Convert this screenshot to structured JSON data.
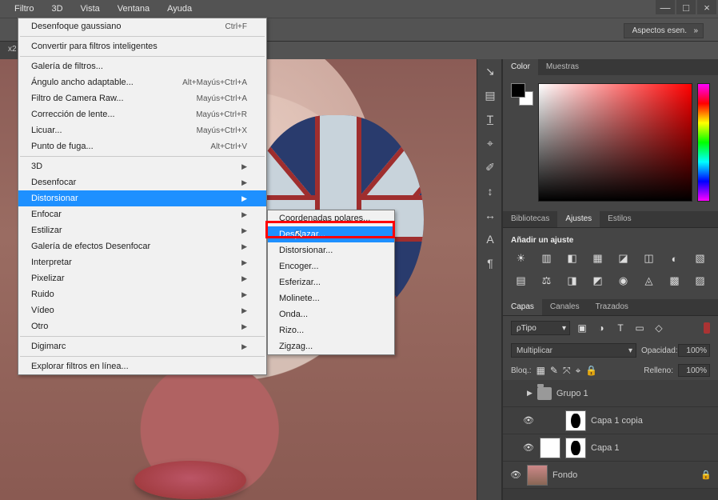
{
  "menubar": {
    "items": [
      "Filtro",
      "3D",
      "Vista",
      "Ventana",
      "Ayuda"
    ]
  },
  "win": {
    "min": "—",
    "max": "□",
    "close": "×"
  },
  "optbar": {
    "aspectos": "Aspectos esen."
  },
  "doc_tab": "x2",
  "vstrip": [
    "↘",
    "▤",
    "T̲",
    "⌖",
    "✐",
    "↕",
    "↔",
    "A",
    "¶"
  ],
  "color_panel": {
    "tabs": [
      "Color",
      "Muestras"
    ],
    "active": 0
  },
  "adj_panel": {
    "tabs": [
      "Bibliotecas",
      "Ajustes",
      "Estilos"
    ],
    "active": 1,
    "title": "Añadir un ajuste",
    "icons_row1": [
      "☀",
      "▥",
      "◧",
      "▦",
      "◪",
      "◫",
      "◐",
      "▧"
    ],
    "icons_row2": [
      "▤",
      "⚖",
      "◨",
      "◩",
      "◉",
      "◬",
      "▩",
      "▨"
    ]
  },
  "lay_panel": {
    "tabs": [
      "Capas",
      "Canales",
      "Trazados"
    ],
    "active": 0,
    "kind_label": "Tipo",
    "filter_icons": [
      "▣",
      "◑",
      "T",
      "▭",
      "◇"
    ],
    "blend_mode": "Multiplicar",
    "opacity_label": "Opacidad:",
    "opacity_value": "100%",
    "lock_label": "Bloq.:",
    "lock_icons": [
      "▦",
      "✎",
      "⤧",
      "⌖",
      "🔒"
    ],
    "fill_label": "Relleno:",
    "fill_value": "100%",
    "layers": [
      {
        "eye": "",
        "group": true,
        "name": "Grupo 1"
      },
      {
        "eye": "👁",
        "hi": true,
        "flag": true,
        "mask": true,
        "name": "Capa 1 copia"
      },
      {
        "eye": "👁",
        "white": true,
        "mask": true,
        "name": "Capa 1"
      },
      {
        "eye": "👁",
        "img": true,
        "name": "Fondo",
        "lock": true
      }
    ]
  },
  "menu": {
    "title": "Filtro",
    "items": [
      {
        "label": "Desenfoque gaussiano",
        "shortcut": "Ctrl+F"
      },
      {
        "sep": true
      },
      {
        "label": "Convertir para filtros inteligentes"
      },
      {
        "sep": true
      },
      {
        "label": "Galería de filtros..."
      },
      {
        "label": "Ángulo ancho adaptable...",
        "shortcut": "Alt+Mayús+Ctrl+A"
      },
      {
        "label": "Filtro de Camera Raw...",
        "shortcut": "Mayús+Ctrl+A"
      },
      {
        "label": "Corrección de lente...",
        "shortcut": "Mayús+Ctrl+R"
      },
      {
        "label": "Licuar...",
        "shortcut": "Mayús+Ctrl+X"
      },
      {
        "label": "Punto de fuga...",
        "shortcut": "Alt+Ctrl+V"
      },
      {
        "sep": true
      },
      {
        "label": "3D",
        "sub": true
      },
      {
        "label": "Desenfocar",
        "sub": true
      },
      {
        "label": "Distorsionar",
        "sub": true,
        "hover": true
      },
      {
        "label": "Enfocar",
        "sub": true
      },
      {
        "label": "Estilizar",
        "sub": true
      },
      {
        "label": "Galería de efectos Desenfocar",
        "sub": true
      },
      {
        "label": "Interpretar",
        "sub": true
      },
      {
        "label": "Pixelizar",
        "sub": true
      },
      {
        "label": "Ruido",
        "sub": true
      },
      {
        "label": "Vídeo",
        "sub": true
      },
      {
        "label": "Otro",
        "sub": true
      },
      {
        "sep": true
      },
      {
        "label": "Digimarc",
        "sub": true
      },
      {
        "sep": true
      },
      {
        "label": "Explorar filtros en línea..."
      }
    ]
  },
  "submenu": {
    "items": [
      {
        "label": "Coordenadas polares..."
      },
      {
        "label": "Desplazar...",
        "hl": true
      },
      {
        "label": "Distorsionar..."
      },
      {
        "label": "Encoger..."
      },
      {
        "label": "Esferizar..."
      },
      {
        "label": "Molinete..."
      },
      {
        "label": "Onda..."
      },
      {
        "label": "Rizo..."
      },
      {
        "label": "Zigzag..."
      }
    ]
  }
}
